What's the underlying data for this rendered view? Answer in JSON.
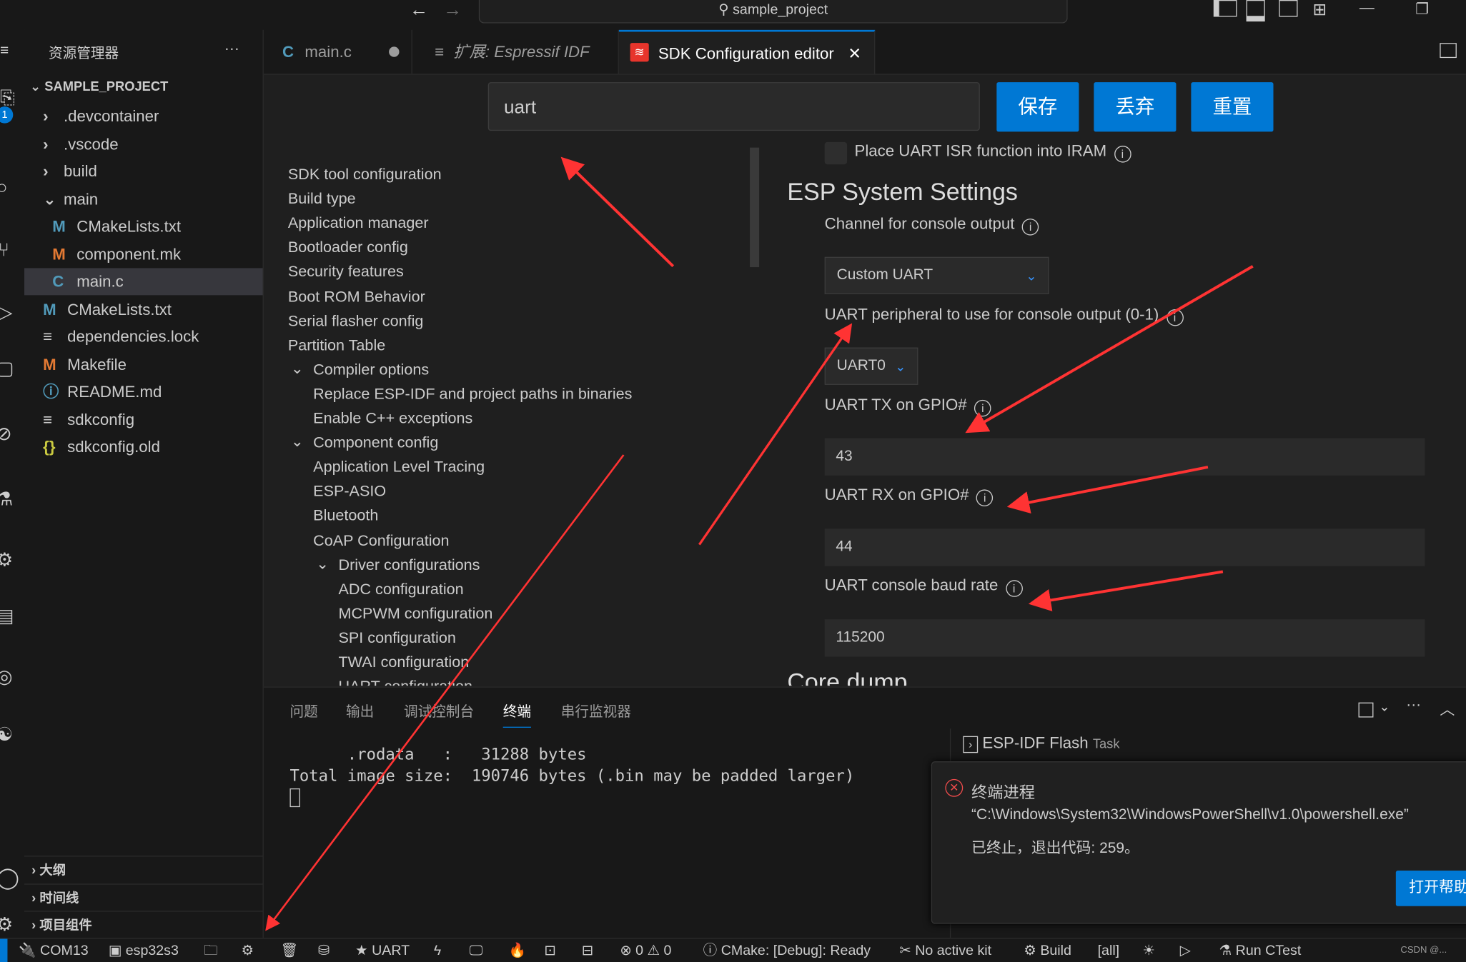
{
  "titlebar": {
    "search": "sample_project",
    "back_icon": "arrow-left",
    "forward_icon": "arrow-right"
  },
  "explorer": {
    "title": "资源管理器",
    "more": "···",
    "project": "SAMPLE_PROJECT",
    "items": [
      {
        "label": ".devcontainer",
        "type": "folder",
        "icon": "chevron-right"
      },
      {
        "label": ".vscode",
        "type": "folder",
        "icon": "chevron-right"
      },
      {
        "label": "build",
        "type": "folder",
        "icon": "chevron-right"
      },
      {
        "label": "main",
        "type": "folder-open",
        "icon": "chevron-down"
      },
      {
        "label": "CMakeLists.txt",
        "type": "cmake",
        "glyph": "M",
        "color": "#519aba"
      },
      {
        "label": "component.mk",
        "type": "make",
        "glyph": "M",
        "color": "#e37933"
      },
      {
        "label": "main.c",
        "type": "c",
        "glyph": "C",
        "color": "#519aba",
        "selected": true
      },
      {
        "label": "CMakeLists.txt",
        "type": "cmake",
        "glyph": "M",
        "color": "#519aba"
      },
      {
        "label": "dependencies.lock",
        "type": "text",
        "glyph": "≡",
        "color": "#ccc"
      },
      {
        "label": "Makefile",
        "type": "make",
        "glyph": "M",
        "color": "#e37933"
      },
      {
        "label": "README.md",
        "type": "info",
        "glyph": "ⓘ",
        "color": "#519aba"
      },
      {
        "label": "sdkconfig",
        "type": "text",
        "glyph": "≡",
        "color": "#ccc"
      },
      {
        "label": "sdkconfig.old",
        "type": "json",
        "glyph": "{}",
        "color": "#cbcb41"
      }
    ],
    "sections": [
      "大纲",
      "时间线",
      "项目组件"
    ],
    "badges": [
      "1",
      "1"
    ]
  },
  "tabs": [
    {
      "label": "main.c",
      "glyph": "C",
      "modified": true
    },
    {
      "label": "扩展: Espressif IDF",
      "glyph": "≡",
      "italic": true
    },
    {
      "label": "SDK Configuration editor",
      "active": true,
      "close": "✕"
    }
  ],
  "sdk": {
    "search_value": "uart",
    "save": "保存",
    "discard": "丢弃",
    "reset": "重置",
    "menu": [
      {
        "label": "SDK tool configuration",
        "level": 0
      },
      {
        "label": "Build type",
        "level": 0
      },
      {
        "label": "Application manager",
        "level": 0
      },
      {
        "label": "Bootloader config",
        "level": 0
      },
      {
        "label": "Security features",
        "level": 0
      },
      {
        "label": "Boot ROM Behavior",
        "level": 0
      },
      {
        "label": "Serial flasher config",
        "level": 0
      },
      {
        "label": "Partition Table",
        "level": 0
      },
      {
        "label": "Compiler options",
        "level": 0,
        "expanded": true
      },
      {
        "label": "Replace ESP-IDF and project paths in binaries",
        "level": 1
      },
      {
        "label": "Enable C++ exceptions",
        "level": 1
      },
      {
        "label": "Component config",
        "level": 0,
        "expanded": true
      },
      {
        "label": "Application Level Tracing",
        "level": 1
      },
      {
        "label": "ESP-ASIO",
        "level": 1
      },
      {
        "label": "Bluetooth",
        "level": 1
      },
      {
        "label": "CoAP Configuration",
        "level": 1
      },
      {
        "label": "Driver configurations",
        "level": 1,
        "expanded": true
      },
      {
        "label": "ADC configuration",
        "level": 2
      },
      {
        "label": "MCPWM configuration",
        "level": 2
      },
      {
        "label": "SPI configuration",
        "level": 2
      },
      {
        "label": "TWAI configuration",
        "level": 2
      },
      {
        "label": "UART configuration",
        "level": 2
      }
    ],
    "isr_label": "Place UART ISR function into IRAM",
    "section_title": "ESP System Settings",
    "channel_label": "Channel for console output",
    "channel_value": "Custom UART",
    "peripheral_label": "UART peripheral to use for console output (0-1)",
    "peripheral_value": "UART0",
    "tx_label": "UART TX on GPIO#",
    "tx_value": "43",
    "rx_label": "UART RX on GPIO#",
    "rx_value": "44",
    "baud_label": "UART console baud rate",
    "baud_value": "115200",
    "next_section": "Core dump"
  },
  "panel": {
    "tabs": [
      "问题",
      "输出",
      "调试控制台",
      "终端",
      "串行监视器"
    ],
    "active_tab": "终端",
    "terminal_lines": [
      "      .rodata   :   31288 bytes",
      "Total image size:  190746 bytes (.bin may be padded larger)"
    ],
    "task_label": "ESP-IDF Flash",
    "task_suffix": "Task"
  },
  "toast": {
    "title": "终端进程",
    "line1": "“C:\\Windows\\System32\\WindowsPowerShell\\v1.0\\powershell.exe”",
    "line2": "已终止，退出代码: 259。",
    "button": "打开帮助"
  },
  "statusbar": {
    "port": "COM13",
    "target": "esp32s3",
    "uart": "UART",
    "errors": "0",
    "warnings": "0",
    "cmake": "CMake: [Debug]: Ready",
    "kit": "No active kit",
    "build": "Build",
    "all": "[all]",
    "ctest": "Run CTest",
    "watermark": "CSDN @..."
  },
  "colors": {
    "accent": "#0078d4",
    "annotation": "#ff3333",
    "error": "#f14c4c"
  }
}
